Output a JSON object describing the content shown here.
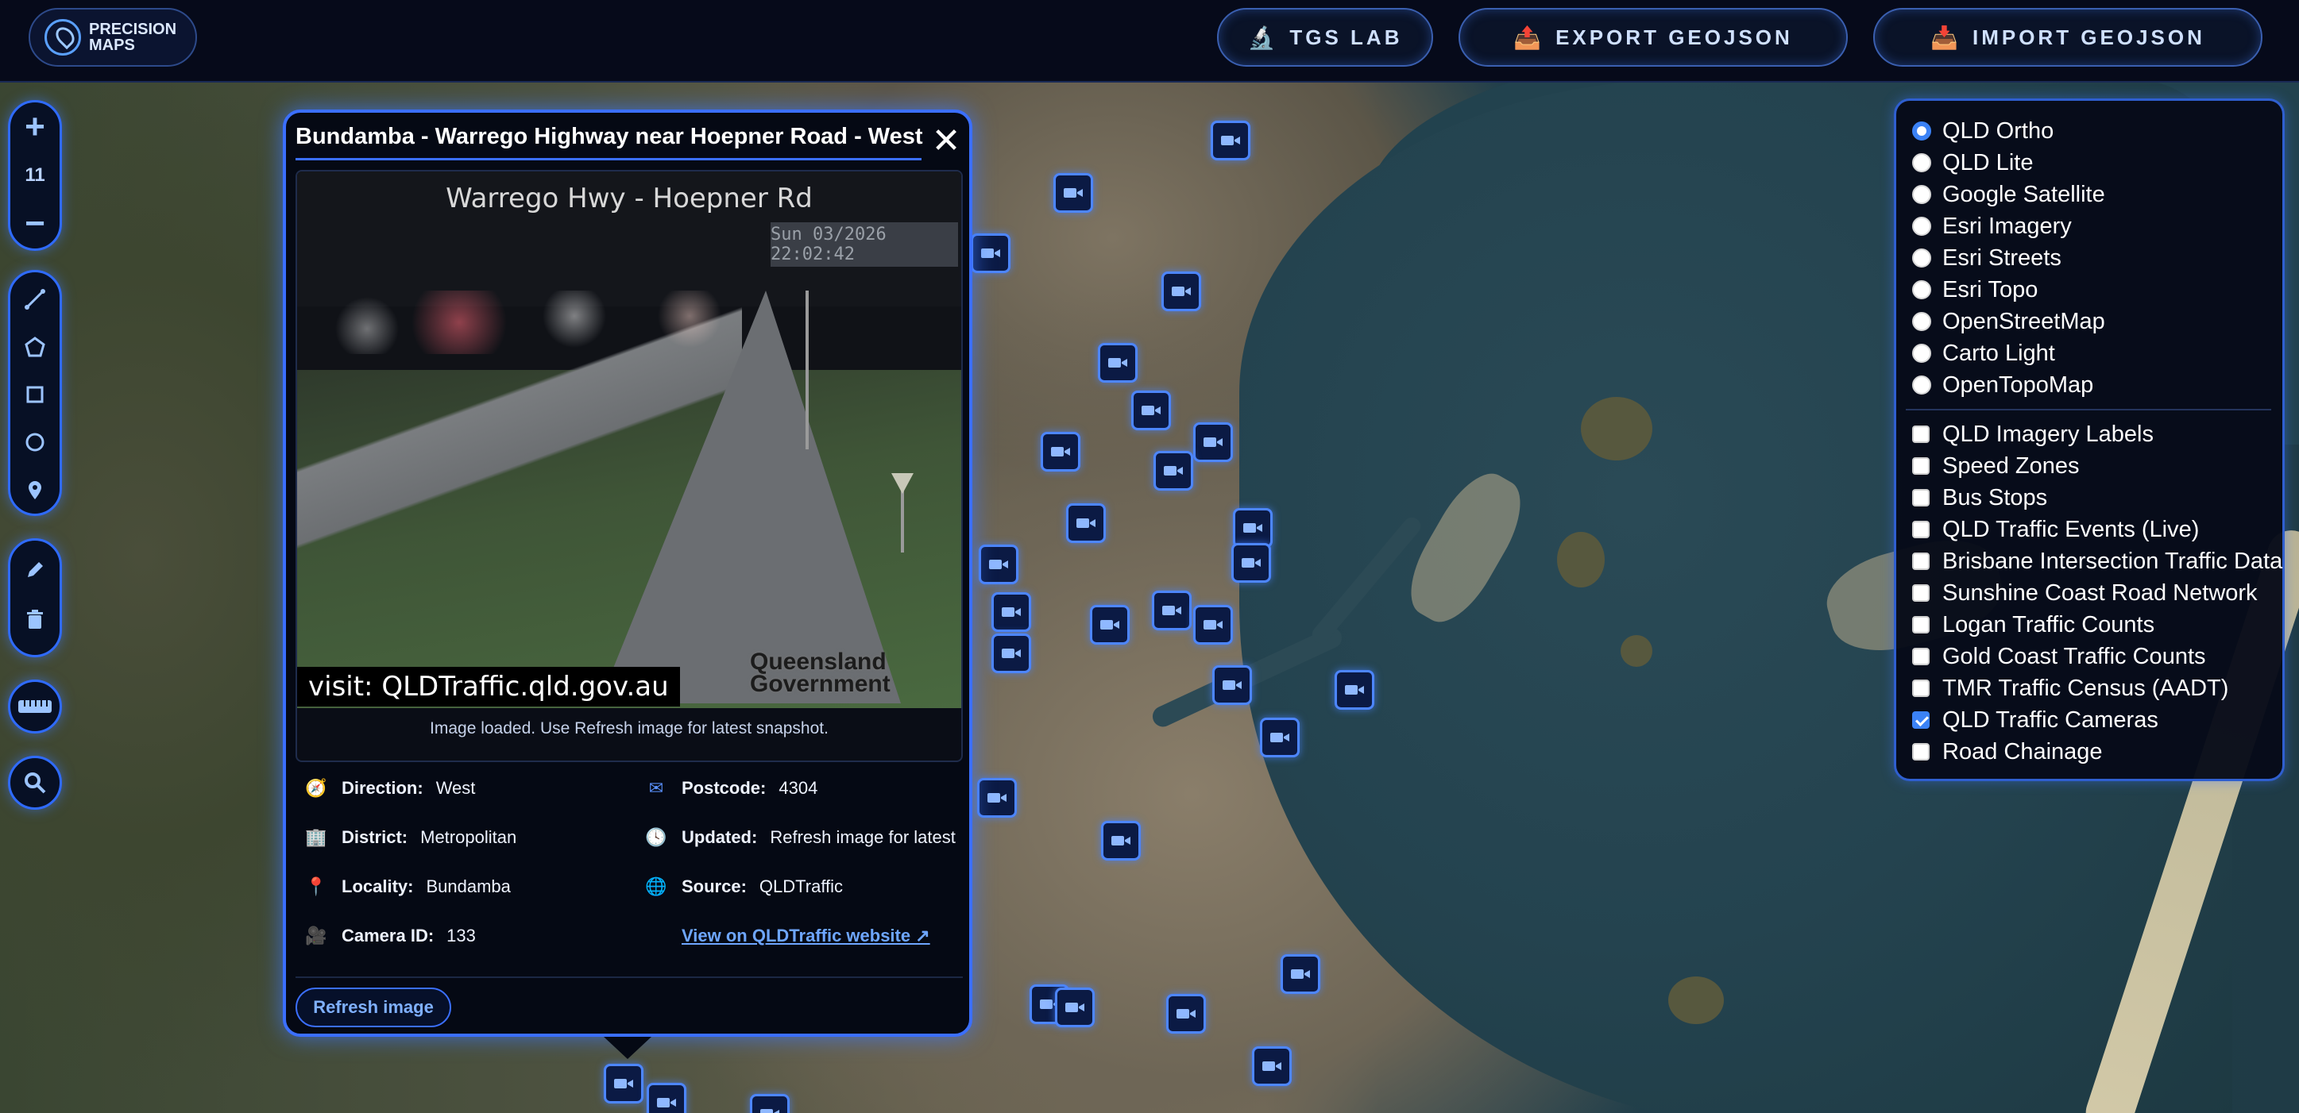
{
  "app": {
    "logo_text": "PRECISION MAPS"
  },
  "topbar": {
    "buttons": [
      {
        "label": "TGS LAB",
        "icon": "microscope-icon"
      },
      {
        "label": "EXPORT GEOJSON",
        "icon": "tray-export-icon"
      },
      {
        "label": "IMPORT GEOJSON",
        "icon": "tray-import-icon"
      }
    ]
  },
  "toolbar": {
    "zoom_in": "+",
    "zoom_level": "11",
    "zoom_out": "−",
    "draw_tools": [
      "polyline-icon",
      "polygon-icon",
      "rectangle-icon",
      "circle-icon",
      "marker-icon"
    ],
    "edit_tools": [
      "edit-pencil-icon",
      "trash-icon"
    ],
    "measure_icon": "ruler-icon",
    "search_icon": "search-icon"
  },
  "popup": {
    "title": "Bundamba - Warrego Highway near Hoepner Road - West",
    "close": "✕",
    "image": {
      "overlay_title": "Warrego Hwy - Hoepner Rd",
      "timestamp": "Sun 03/2026 22:02:42",
      "footer": "visit: QLDTraffic.qld.gov.au",
      "logo_line1": "Queensland",
      "logo_line2": "Government"
    },
    "image_status": "Image loaded. Use Refresh image for latest snapshot.",
    "fields": {
      "direction": {
        "label": "Direction:",
        "value": "West"
      },
      "postcode": {
        "label": "Postcode:",
        "value": "4304"
      },
      "district": {
        "label": "District:",
        "value": "Metropolitan"
      },
      "updated": {
        "label": "Updated:",
        "value": "Refresh image for latest"
      },
      "locality": {
        "label": "Locality:",
        "value": "Bundamba"
      },
      "source": {
        "label": "Source:",
        "value": "QLDTraffic"
      },
      "camera_id": {
        "label": "Camera ID:",
        "value": "133"
      },
      "website_link": "View on QLDTraffic website ↗"
    },
    "refresh_button": "Refresh image"
  },
  "layers": {
    "basemaps": [
      {
        "label": "QLD Ortho",
        "selected": true
      },
      {
        "label": "QLD Lite",
        "selected": false
      },
      {
        "label": "Google Satellite",
        "selected": false
      },
      {
        "label": "Esri Imagery",
        "selected": false
      },
      {
        "label": "Esri Streets",
        "selected": false
      },
      {
        "label": "Esri Topo",
        "selected": false
      },
      {
        "label": "OpenStreetMap",
        "selected": false
      },
      {
        "label": "Carto Light",
        "selected": false
      },
      {
        "label": "OpenTopoMap",
        "selected": false
      }
    ],
    "overlays": [
      {
        "label": "QLD Imagery Labels",
        "checked": false
      },
      {
        "label": "Speed Zones",
        "checked": false
      },
      {
        "label": "Bus Stops",
        "checked": false
      },
      {
        "label": "QLD Traffic Events (Live)",
        "checked": false
      },
      {
        "label": "Brisbane Intersection Traffic Data",
        "checked": false
      },
      {
        "label": "Sunshine Coast Road Network",
        "checked": false
      },
      {
        "label": "Logan Traffic Counts",
        "checked": false
      },
      {
        "label": "Gold Coast Traffic Counts",
        "checked": false
      },
      {
        "label": "TMR Traffic Census (AADT)",
        "checked": false
      },
      {
        "label": "QLD Traffic Cameras",
        "checked": true
      },
      {
        "label": "Road Chainage",
        "checked": false
      }
    ]
  },
  "colors": {
    "accent": "#3b6fff",
    "marker_border": "#4d86ff",
    "link": "#6ea6ff"
  }
}
